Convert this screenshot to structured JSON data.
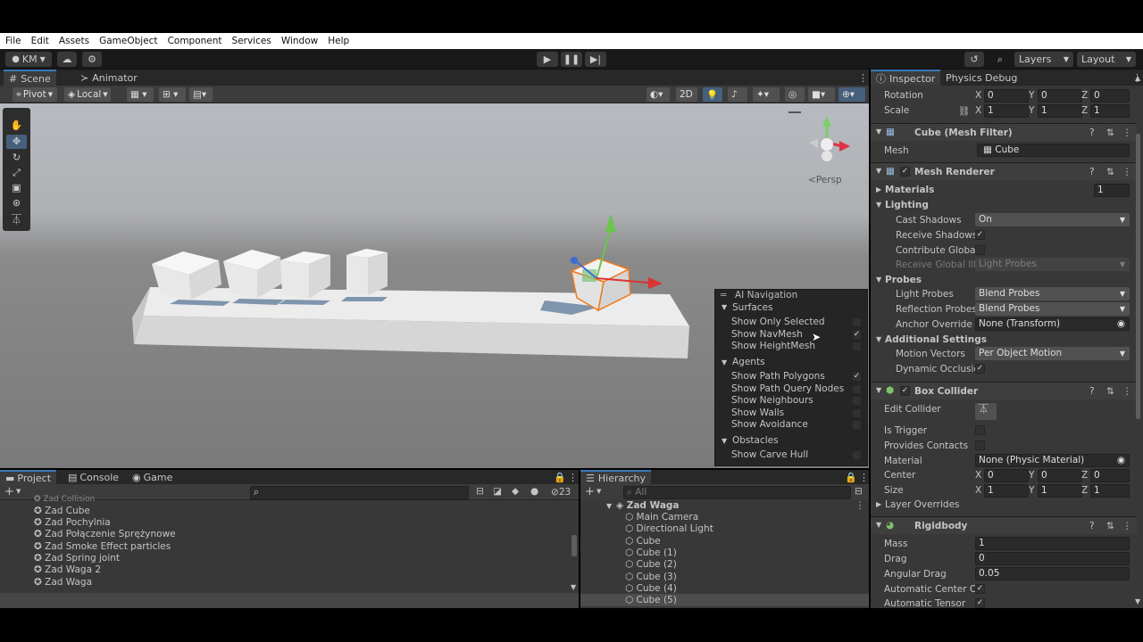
{
  "menu": [
    "File",
    "Edit",
    "Assets",
    "GameObject",
    "Component",
    "Services",
    "Window",
    "Help"
  ],
  "toolbar": {
    "account": "KM",
    "layers": "Layers",
    "layout": "Layout"
  },
  "tabs": {
    "scene": "Scene",
    "animator": "Animator",
    "inspector": "Inspector",
    "physics_debug": "Physics Debug",
    "project": "Project",
    "console": "Console",
    "game": "Game",
    "hierarchy": "Hierarchy"
  },
  "scene_toolbar": {
    "pivot": "Pivot",
    "local": "Local",
    "mode2d": "2D"
  },
  "scene": {
    "persp": "Persp"
  },
  "nav_overlay": {
    "title": "AI Navigation",
    "surfaces": "Surfaces",
    "surface_items": [
      {
        "label": "Show Only Selected",
        "checked": false
      },
      {
        "label": "Show NavMesh",
        "checked": true
      },
      {
        "label": "Show HeightMesh",
        "checked": false
      }
    ],
    "agents": "Agents",
    "agent_items": [
      {
        "label": "Show Path Polygons",
        "checked": true
      },
      {
        "label": "Show Path Query Nodes",
        "checked": false
      },
      {
        "label": "Show Neighbours",
        "checked": false
      },
      {
        "label": "Show Walls",
        "checked": false
      },
      {
        "label": "Show Avoidance",
        "checked": false
      }
    ],
    "obstacles": "Obstacles",
    "obstacle_items": [
      {
        "label": "Show Carve Hull",
        "checked": false
      }
    ]
  },
  "inspector": {
    "rotation": {
      "label": "Rotation",
      "x": "0",
      "y": "0",
      "z": "0"
    },
    "scale": {
      "label": "Scale",
      "x": "1",
      "y": "1",
      "z": "1"
    },
    "mesh_filter": {
      "title": "Cube (Mesh Filter)",
      "mesh_label": "Mesh",
      "mesh_value": "Cube"
    },
    "mesh_renderer": {
      "title": "Mesh Renderer",
      "materials": "Materials",
      "materials_count": "1",
      "lighting": "Lighting",
      "cast_shadows": "Cast Shadows",
      "cast_shadows_value": "On",
      "receive_shadows": "Receive Shadows",
      "contribute_global": "Contribute Global",
      "receive_global": "Receive Global Illi",
      "receive_global_value": "Light Probes",
      "probes": "Probes",
      "light_probes": "Light Probes",
      "light_probes_value": "Blend Probes",
      "reflection_probes": "Reflection Probes",
      "reflection_probes_value": "Blend Probes",
      "anchor_override": "Anchor Override",
      "anchor_override_value": "None (Transform)",
      "additional": "Additional Settings",
      "motion_vectors": "Motion Vectors",
      "motion_vectors_value": "Per Object Motion",
      "dynamic_occlusion": "Dynamic Occlusic"
    },
    "box_collider": {
      "title": "Box Collider",
      "edit_collider": "Edit Collider",
      "is_trigger": "Is Trigger",
      "provides_contacts": "Provides Contacts",
      "material": "Material",
      "material_value": "None (Physic Material)",
      "center": "Center",
      "center_x": "0",
      "center_y": "0",
      "center_z": "0",
      "size": "Size",
      "size_x": "1",
      "size_y": "1",
      "size_z": "1",
      "layer_overrides": "Layer Overrides"
    },
    "rigidbody": {
      "title": "Rigidbody",
      "mass": "Mass",
      "mass_value": "1",
      "drag": "Drag",
      "drag_value": "0",
      "angular_drag": "Angular Drag",
      "angular_drag_value": "0.05",
      "auto_center": "Automatic Center Of",
      "auto_tensor": "Automatic Tensor"
    }
  },
  "project": {
    "items": [
      "Zad Collision",
      "Zad Cube",
      "Zad Pochylnia",
      "Zad Połączenie Sprężynowe",
      "Zad Smoke Effect particles",
      "Zad Spring joint",
      "Zad Waga 2",
      "Zad Waga"
    ],
    "hidden_count": "23"
  },
  "hierarchy": {
    "search_placeholder": "All",
    "scene": "Zad Waga",
    "items": [
      "Main Camera",
      "Directional Light",
      "Cube",
      "Cube (1)",
      "Cube (2)",
      "Cube (3)",
      "Cube (4)",
      "Cube (5)"
    ]
  }
}
